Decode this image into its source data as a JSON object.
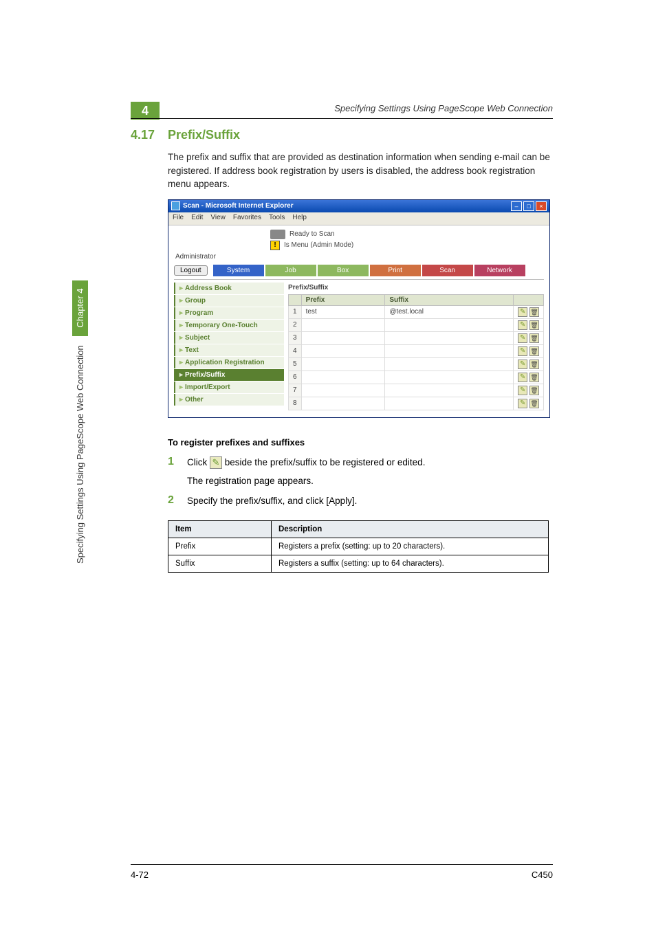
{
  "running_head": "Specifying Settings Using PageScope Web Connection",
  "chapter_box": "4",
  "side_label": "Specifying Settings Using PageScope Web Connection",
  "side_chapter": "Chapter 4",
  "section": {
    "num": "4.17",
    "title": "Prefix/Suffix"
  },
  "intro": "The prefix and suffix that are provided as destination information when sending e-mail can be registered. If address book registration by users is disabled, the address book registration menu appears.",
  "browser": {
    "title": "Scan - Microsoft Internet Explorer",
    "menus": [
      "File",
      "Edit",
      "View",
      "Favorites",
      "Tools",
      "Help"
    ],
    "status1": "Ready to Scan",
    "status2": "Is Menu (Admin Mode)",
    "admin": "Administrator",
    "logout": "Logout",
    "tabs": {
      "system": "System",
      "job": "Job",
      "box": "Box",
      "print": "Print",
      "scan": "Scan",
      "network": "Network"
    },
    "sidebar": [
      "Address Book",
      "Group",
      "Program",
      "Temporary One-Touch",
      "Subject",
      "Text",
      "Application Registration",
      "Prefix/Suffix",
      "Import/Export",
      "Other"
    ],
    "current_sidebar_index": 7,
    "panel_title": "Prefix/Suffix",
    "columns": {
      "num": "",
      "prefix": "Prefix",
      "suffix": "Suffix"
    },
    "rows": [
      {
        "n": "1",
        "prefix": "test",
        "suffix": "@test.local"
      },
      {
        "n": "2",
        "prefix": "",
        "suffix": ""
      },
      {
        "n": "3",
        "prefix": "",
        "suffix": ""
      },
      {
        "n": "4",
        "prefix": "",
        "suffix": ""
      },
      {
        "n": "5",
        "prefix": "",
        "suffix": ""
      },
      {
        "n": "6",
        "prefix": "",
        "suffix": ""
      },
      {
        "n": "7",
        "prefix": "",
        "suffix": ""
      },
      {
        "n": "8",
        "prefix": "",
        "suffix": ""
      }
    ]
  },
  "subhead": "To register prefixes and suffixes",
  "steps": {
    "s1a": "Click ",
    "s1b": " beside the prefix/suffix to be registered or edited.",
    "s1sub": "The registration page appears.",
    "s2": "Specify the prefix/suffix, and click [Apply]."
  },
  "table": {
    "h1": "Item",
    "h2": "Description",
    "r1k": "Prefix",
    "r1v": "Registers a prefix (setting: up to 20 characters).",
    "r2k": "Suffix",
    "r2v": "Registers a suffix (setting: up to 64 characters)."
  },
  "footer": {
    "left": "4-72",
    "right": "C450"
  }
}
